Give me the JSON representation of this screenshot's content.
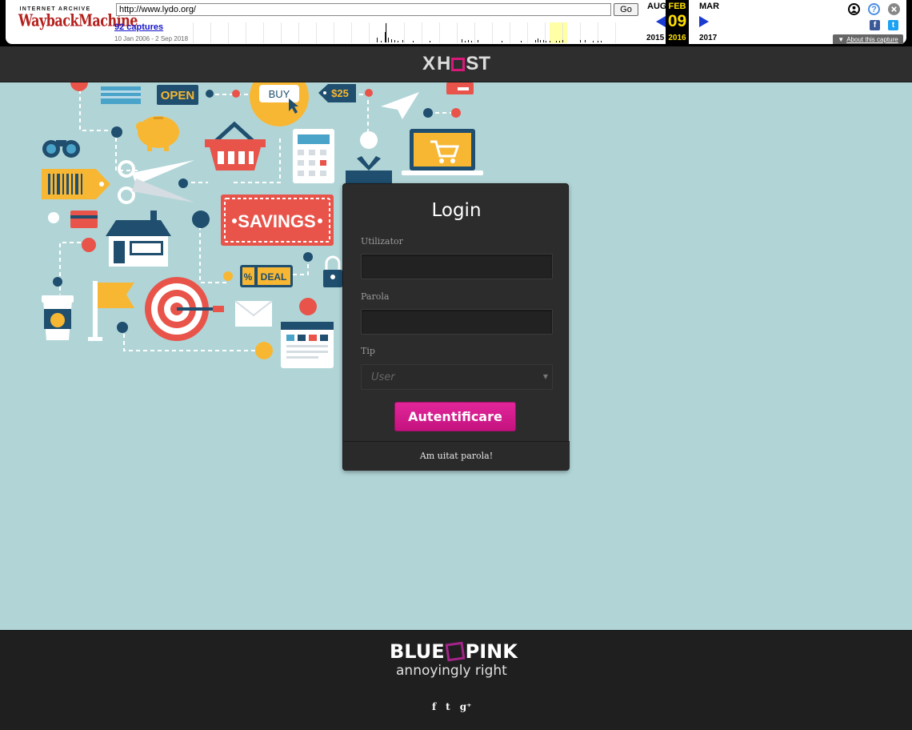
{
  "wayback": {
    "logo_top": "INTERNET ARCHIVE",
    "logo_main": "WaybackMachine",
    "url": "http://www.lydo.org/",
    "go_label": "Go",
    "captures": "92 captures",
    "range": "10 Jan 2006 - 2 Sep 2018",
    "prev_month": "AUG",
    "cur_month": "FEB",
    "next_month": "MAR",
    "day": "09",
    "prev_year": "2015",
    "cur_year": "2016",
    "next_year": "2017",
    "about": "About this capture",
    "help_glyph": "?",
    "facebook_glyph": "f",
    "twitter_glyph": "t",
    "about_glyph": "▼"
  },
  "header": {
    "logo_left": "X",
    "logo_right": "ST"
  },
  "illustration": {
    "open_sign": "OPEN",
    "buy_button": "BUY",
    "price_tag": "$25",
    "savings": "SAVINGS",
    "deal_percent": "%",
    "deal_label": "DEAL"
  },
  "login": {
    "title": "Login",
    "username_label": "Utilizator",
    "password_label": "Parola",
    "type_label": "Tip",
    "type_value": "User",
    "select_arrow": "▼",
    "submit": "Autentificare",
    "forgot": "Am uitat parola!"
  },
  "footer": {
    "brand_left": "BLUE",
    "brand_right": "PINK",
    "tagline": "annoyingly right",
    "social": {
      "facebook": "f",
      "twitter": "t",
      "google": "g⁺"
    }
  }
}
